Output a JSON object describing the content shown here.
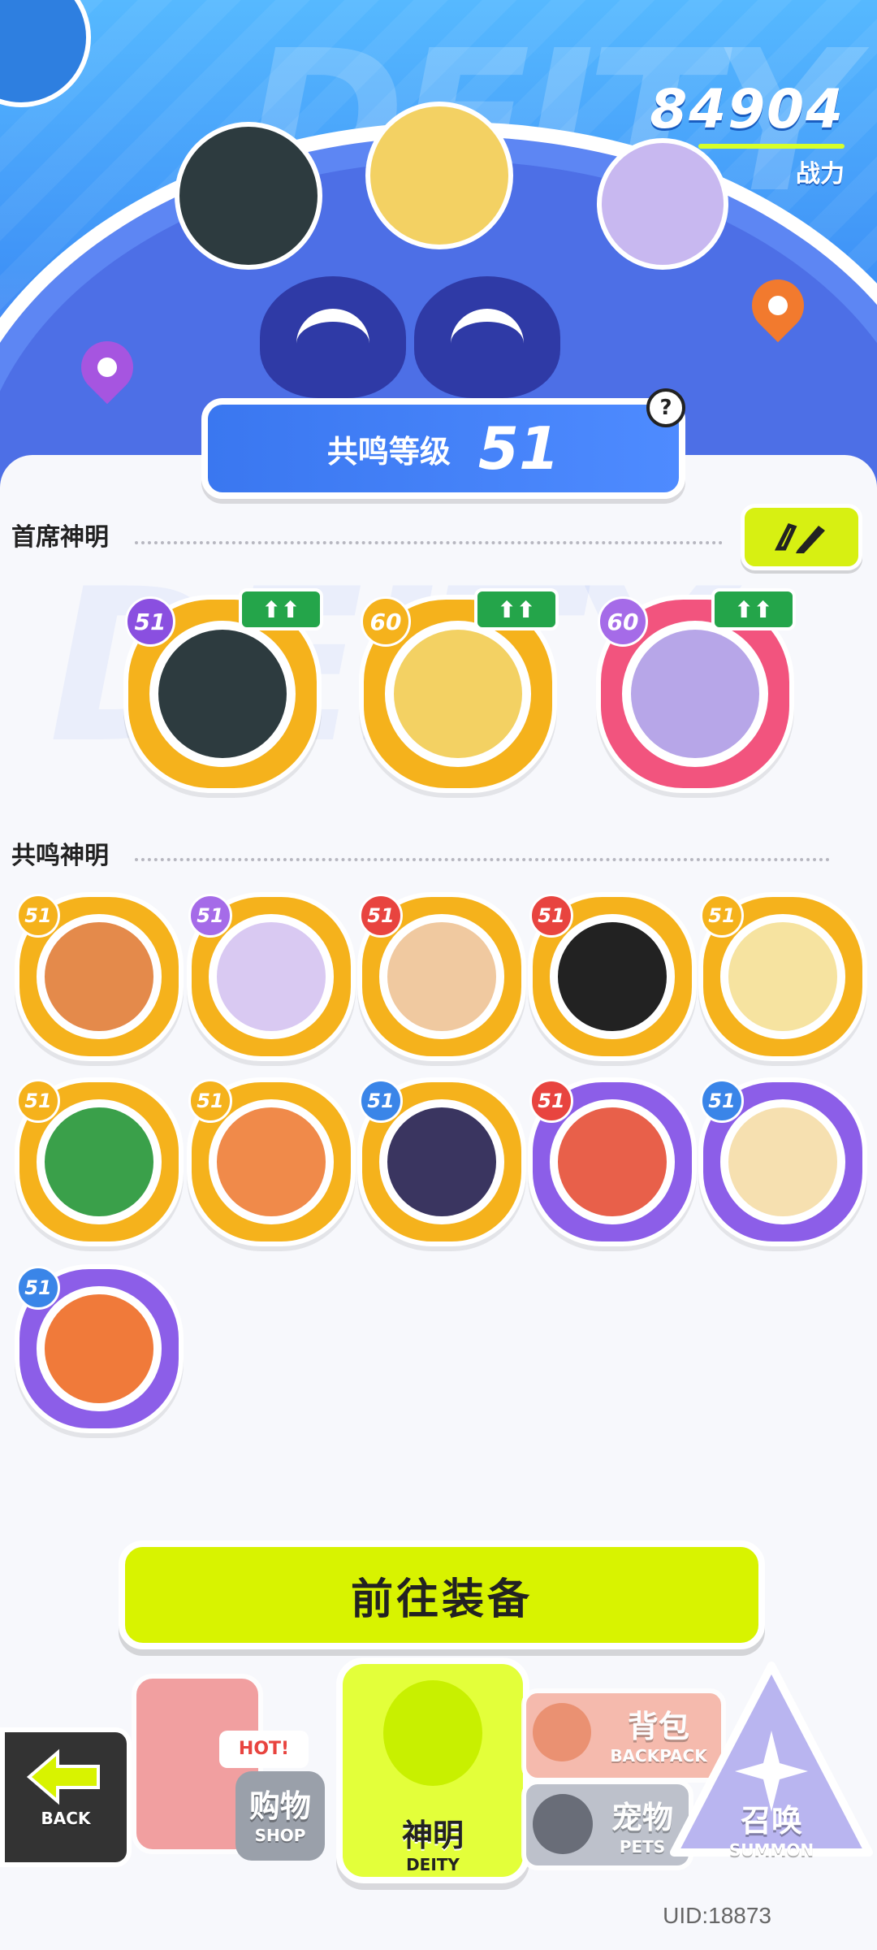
{
  "header": {
    "power_value": "84904",
    "power_label": "战力",
    "watermark": "DEITY"
  },
  "resonance": {
    "label": "共鸣等级",
    "level": "51",
    "help": "?"
  },
  "chief": {
    "title": "首席神明",
    "edit_icon": "pencil-icon",
    "upgrade_glyph": "⬆⬆",
    "deities": [
      {
        "level": "51",
        "frame": "#f5b21c",
        "lvcolor": "#8a4fe0",
        "face": "#2d3b3f"
      },
      {
        "level": "60",
        "frame": "#f5b21c",
        "lvcolor": "#f5b21c",
        "face": "#f3d163"
      },
      {
        "level": "60",
        "frame": "#f2547e",
        "lvcolor": "#a56be8",
        "face": "#b7a6e8"
      }
    ]
  },
  "resonant": {
    "title": "共鸣神明",
    "deities": [
      {
        "level": "51",
        "frame": "#f5b21c",
        "lvcolor": "#f5b21c",
        "face": "#e48a4b"
      },
      {
        "level": "51",
        "frame": "#f5b21c",
        "lvcolor": "#a56be8",
        "face": "#d9c9f2"
      },
      {
        "level": "51",
        "frame": "#f5b21c",
        "lvcolor": "#e8443f",
        "face": "#f0c9a0"
      },
      {
        "level": "51",
        "frame": "#f5b21c",
        "lvcolor": "#e8443f",
        "face": "#222222"
      },
      {
        "level": "51",
        "frame": "#f5b21c",
        "lvcolor": "#f5b21c",
        "face": "#f6e3a0"
      },
      {
        "level": "51",
        "frame": "#f5b21c",
        "lvcolor": "#f5b21c",
        "face": "#3aa04a"
      },
      {
        "level": "51",
        "frame": "#f5b21c",
        "lvcolor": "#f5b21c",
        "face": "#f08a4a"
      },
      {
        "level": "51",
        "frame": "#f5b21c",
        "lvcolor": "#3a85e8",
        "face": "#3a3560"
      },
      {
        "level": "51",
        "frame": "#8c5ee8",
        "lvcolor": "#e8443f",
        "face": "#e8604a"
      },
      {
        "level": "51",
        "frame": "#8c5ee8",
        "lvcolor": "#3a85e8",
        "face": "#f6e0b0"
      },
      {
        "level": "51",
        "frame": "#8c5ee8",
        "lvcolor": "#3a85e8",
        "face": "#f07a3a"
      }
    ]
  },
  "equip_button": "前往装备",
  "bottom_nav": {
    "back": "BACK",
    "shop_cn": "购物",
    "shop_en": "SHOP",
    "shop_tag": "HOT!",
    "deity_cn": "神明",
    "deity_en": "DEITY",
    "backpack_cn": "背包",
    "backpack_en": "BACKPACK",
    "pets_cn": "宠物",
    "pets_en": "PETS",
    "summon_cn": "召唤",
    "summon_en": "SUMMON"
  },
  "uid": "UID:18873",
  "colors": {
    "accent_lime": "#d8f300",
    "hero_blue": "#3f93f7",
    "upgrade_green": "#24a54a"
  }
}
